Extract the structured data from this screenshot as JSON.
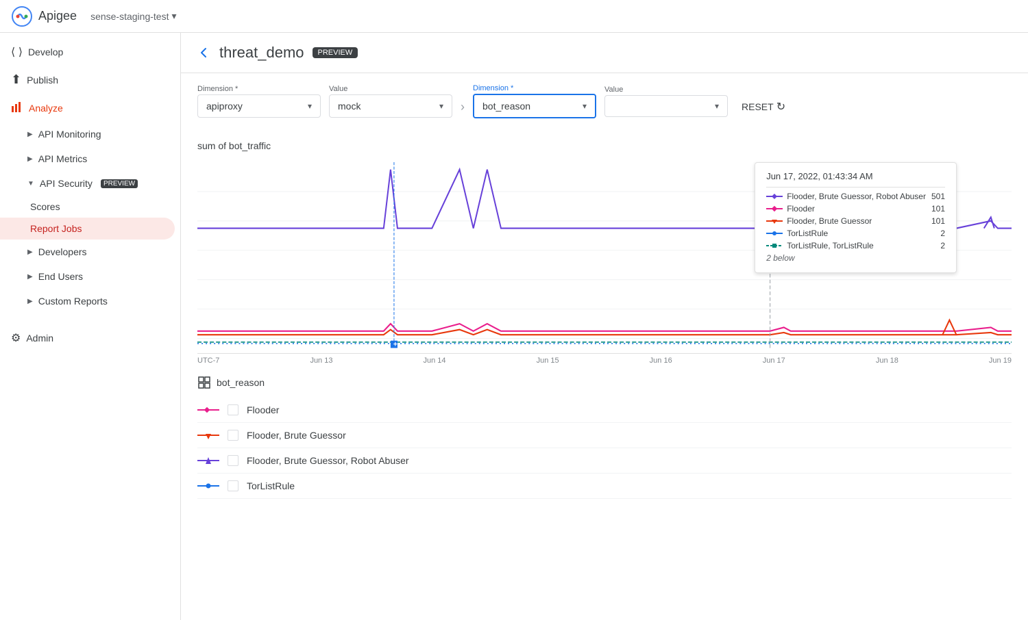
{
  "topbar": {
    "app_name": "Apigee",
    "org_name": "sense-staging-test"
  },
  "sidebar": {
    "items": [
      {
        "id": "develop",
        "label": "Develop",
        "icon": "code-icon",
        "active": false,
        "expanded": false
      },
      {
        "id": "publish",
        "label": "Publish",
        "icon": "publish-icon",
        "active": false,
        "expanded": false
      },
      {
        "id": "analyze",
        "label": "Analyze",
        "icon": "chart-icon",
        "active": true,
        "expanded": true
      },
      {
        "id": "api-monitoring",
        "label": "API Monitoring",
        "active": false,
        "child": true
      },
      {
        "id": "api-metrics",
        "label": "API Metrics",
        "active": false,
        "child": true
      },
      {
        "id": "api-security",
        "label": "API Security",
        "active": true,
        "child": true,
        "preview": true
      },
      {
        "id": "scores",
        "label": "Scores",
        "active": false,
        "child2": true
      },
      {
        "id": "report-jobs",
        "label": "Report Jobs",
        "active": true,
        "child2": true
      },
      {
        "id": "developers",
        "label": "Developers",
        "active": false,
        "child": true
      },
      {
        "id": "end-users",
        "label": "End Users",
        "active": false,
        "child": true
      },
      {
        "id": "custom-reports",
        "label": "Custom Reports",
        "active": false,
        "child": true
      }
    ],
    "admin": {
      "label": "Admin",
      "icon": "settings-icon"
    }
  },
  "page": {
    "title": "threat_demo",
    "preview_label": "PREVIEW"
  },
  "filters": {
    "dimension1_label": "Dimension *",
    "dimension1_value": "apiproxy",
    "value1_label": "Value",
    "value1_value": "mock",
    "dimension2_label": "Dimension *",
    "dimension2_value": "bot_reason",
    "value2_label": "Value",
    "value2_value": "",
    "reset_label": "RESET"
  },
  "chart": {
    "title": "sum of bot_traffic",
    "x_labels": [
      "UTC-7",
      "Jun 13",
      "Jun 14",
      "Jun 15",
      "Jun 16",
      "Jun 17",
      "Jun 18",
      "Jun 19"
    ],
    "tooltip": {
      "date": "Jun 17, 2022, 01:43:34 AM",
      "rows": [
        {
          "label": "Flooder, Brute Guessor, Robot Abuser",
          "value": "501",
          "color": "#6741d9",
          "line_type": "solid"
        },
        {
          "label": "Flooder",
          "value": "101",
          "color": "#e91e8c",
          "line_type": "solid"
        },
        {
          "label": "Flooder, Brute Guessor",
          "value": "101",
          "color": "#e8380d",
          "line_type": "arrow"
        },
        {
          "label": "TorListRule",
          "value": "2",
          "color": "#1a73e8",
          "line_type": "dot"
        },
        {
          "label": "TorListRule, TorListRule",
          "value": "2",
          "color": "#00897b",
          "line_type": "dash"
        },
        {
          "label": "2 below",
          "value": "",
          "color": null,
          "line_type": "below"
        }
      ]
    }
  },
  "legend": {
    "title": "bot_reason",
    "items": [
      {
        "label": "Flooder",
        "color": "#e91e8c",
        "line_type": "diamond"
      },
      {
        "label": "Flooder, Brute Guessor",
        "color": "#e8380d",
        "line_type": "arrow-down"
      },
      {
        "label": "Flooder, Brute Guessor, Robot Abuser",
        "color": "#6741d9",
        "line_type": "triangle"
      },
      {
        "label": "TorListRule",
        "color": "#1a73e8",
        "line_type": "dot"
      }
    ]
  }
}
